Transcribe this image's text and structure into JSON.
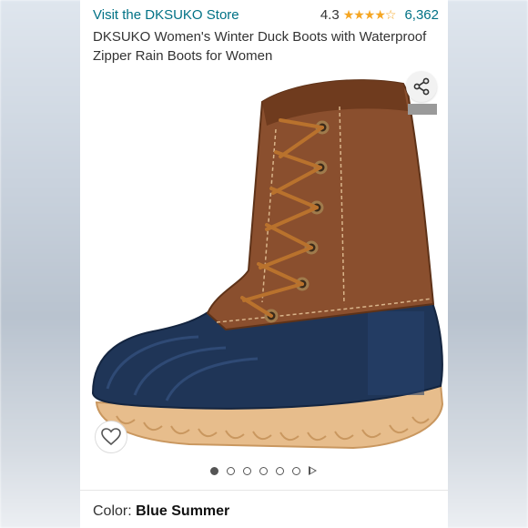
{
  "header": {
    "store_link": "Visit the DKSUKO Store",
    "rating": "4.3",
    "stars": "★★★★☆",
    "review_count": "6,362",
    "title": "DKSUKO Women's Winter Duck Boots with Waterproof Zipper Rain Boots for Women"
  },
  "gallery": {
    "image_count": 5,
    "active_index": 0,
    "share_icon": "share-icon",
    "heart_icon": "heart-icon"
  },
  "color_selection": {
    "label": "Color: ",
    "value": "Blue Summer"
  },
  "colors": {
    "link": "#007185",
    "star": "#f5a623",
    "boot_leather": "#8a4f2e",
    "boot_rubber": "#1f3557",
    "boot_sole": "#e7bd8c"
  }
}
